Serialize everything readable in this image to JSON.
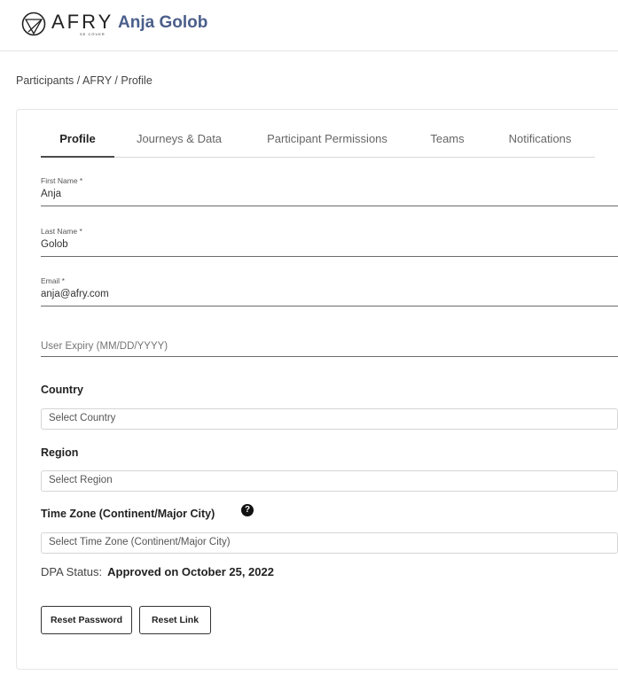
{
  "header": {
    "logo_text": "AFRY",
    "logo_subtext": "SE CÖVER",
    "user_name": "Anja Golob"
  },
  "breadcrumb": [
    "Participants",
    "AFRY",
    "Profile"
  ],
  "breadcrumb_separator": " / ",
  "tabs": [
    {
      "label": "Profile",
      "active": true
    },
    {
      "label": "Journeys & Data",
      "active": false
    },
    {
      "label": "Participant Permissions",
      "active": false
    },
    {
      "label": "Teams",
      "active": false
    },
    {
      "label": "Notifications",
      "active": false
    }
  ],
  "form": {
    "first_name": {
      "label": "First Name *",
      "value": "Anja"
    },
    "last_name": {
      "label": "Last Name *",
      "value": "Golob"
    },
    "email": {
      "label": "Email *",
      "value": "anja@afry.com"
    },
    "user_expiry": {
      "placeholder": "User Expiry (MM/DD/YYYY)"
    },
    "country": {
      "label": "Country",
      "value": "Select Country"
    },
    "region": {
      "label": "Region",
      "value": "Select Region"
    },
    "time_zone": {
      "label": "Time Zone (Continent/Major City)",
      "value": "Select Time Zone (Continent/Major City)",
      "help_icon": "?"
    }
  },
  "dpa": {
    "label": "DPA Status:",
    "value": "Approved on October 25, 2022"
  },
  "buttons": {
    "reset_password": "Reset Password",
    "reset_link": "Reset Link"
  }
}
